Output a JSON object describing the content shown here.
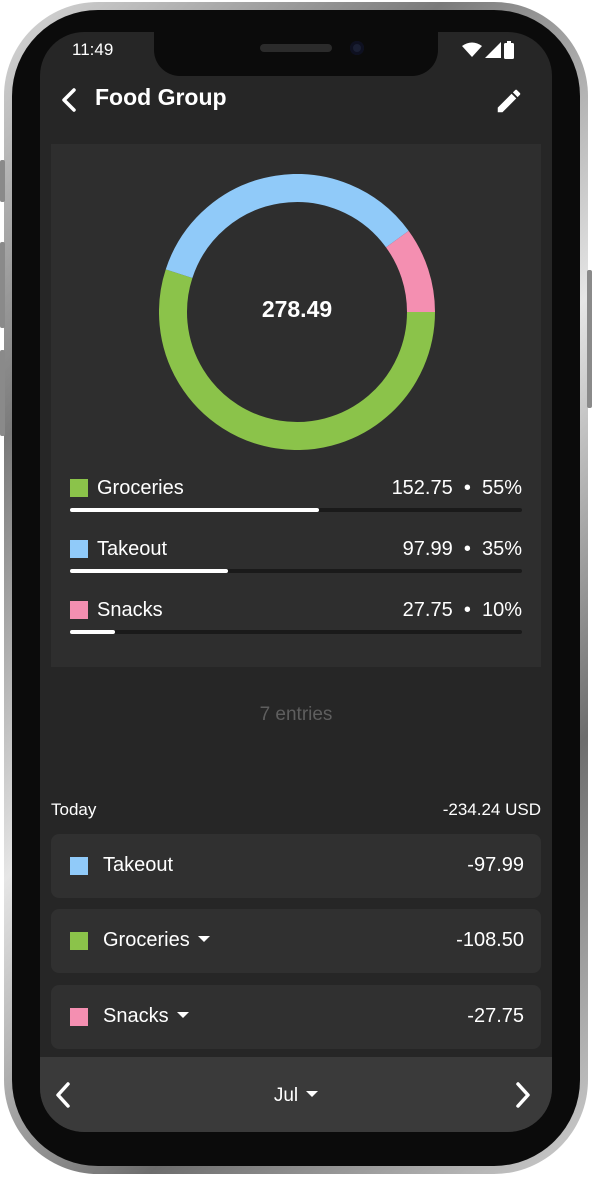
{
  "status": {
    "time": "11:49"
  },
  "header": {
    "title": "Food Group"
  },
  "summary": {
    "total": "278.49",
    "categories": [
      {
        "name": "Groceries",
        "value": "152.75",
        "percent": "55%",
        "color": "#8BC34A",
        "fraction": 0.55
      },
      {
        "name": "Takeout",
        "value": "97.99",
        "percent": "35%",
        "color": "#90CAF9",
        "fraction": 0.35
      },
      {
        "name": "Snacks",
        "value": "27.75",
        "percent": "10%",
        "color": "#F48FB1",
        "fraction": 0.1
      }
    ],
    "entries_label": "7 entries"
  },
  "day_group": {
    "label": "Today",
    "total": "-234.24 USD",
    "transactions": [
      {
        "name": "Takeout",
        "amount": "-97.99",
        "color": "#90CAF9",
        "expandable": false
      },
      {
        "name": "Groceries",
        "amount": "-108.50",
        "color": "#8BC34A",
        "expandable": true
      },
      {
        "name": "Snacks",
        "amount": "-27.75",
        "color": "#F48FB1",
        "expandable": true
      }
    ]
  },
  "bottom_bar": {
    "month": "Jul"
  }
}
